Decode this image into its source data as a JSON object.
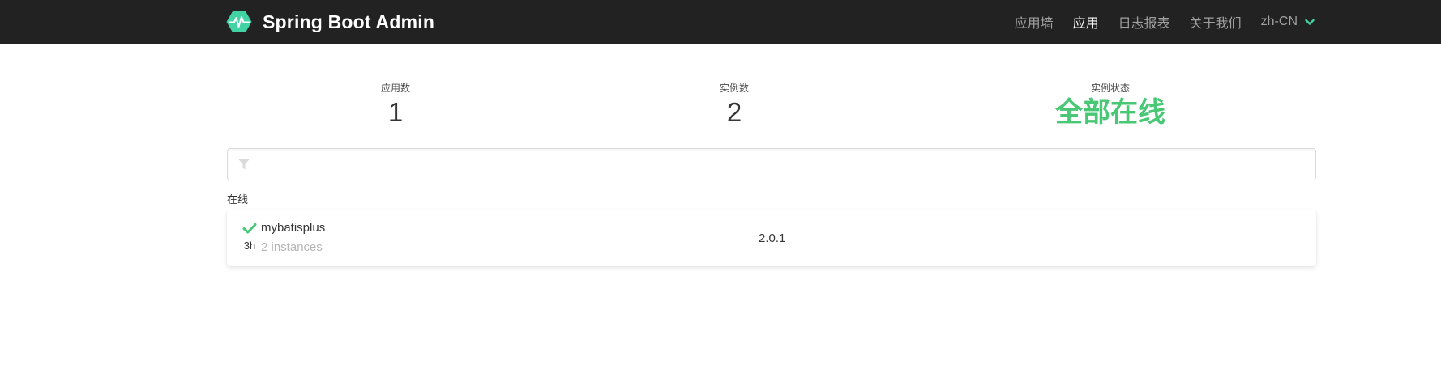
{
  "navbar": {
    "brand_title": "Spring Boot Admin",
    "brand_icon": "heartbeat-hexagon-icon",
    "items": [
      {
        "label": "应用墙",
        "active": false
      },
      {
        "label": "应用",
        "active": true
      },
      {
        "label": "日志报表",
        "active": false
      },
      {
        "label": "关于我们",
        "active": false
      }
    ],
    "language": "zh-CN"
  },
  "stats": {
    "applications": {
      "label": "应用数",
      "value": "1"
    },
    "instances": {
      "label": "实例数",
      "value": "2"
    },
    "status": {
      "label": "实例状态",
      "value": "全部在线"
    }
  },
  "filter": {
    "placeholder": "",
    "value": ""
  },
  "groups": [
    {
      "label": "在线",
      "applications": [
        {
          "name": "mybatisplus",
          "instances": "2 instances",
          "uptime": "3h",
          "version": "2.0.1",
          "status": "UP"
        }
      ]
    }
  ],
  "colors": {
    "navbar": "#222222",
    "brand_accent": "#42d3a5",
    "status_up": "#48c774",
    "muted": "#b5b5b5"
  }
}
